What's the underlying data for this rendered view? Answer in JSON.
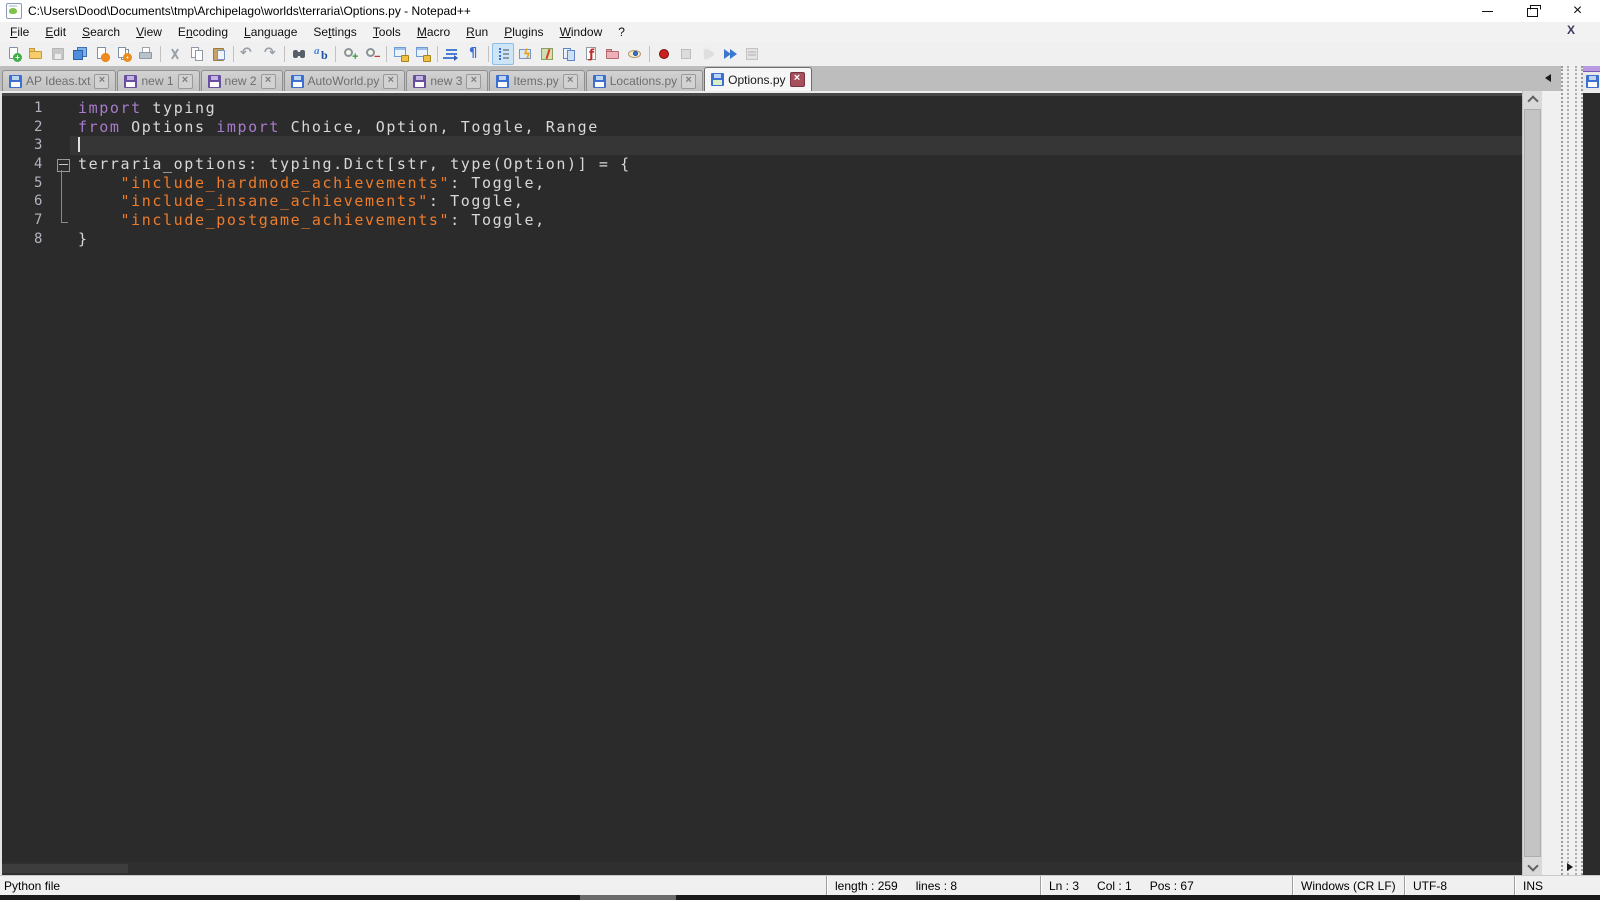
{
  "window": {
    "title": "C:\\Users\\Dood\\Documents\\tmp\\Archipelago\\worlds\\terraria\\Options.py - Notepad++"
  },
  "menu": {
    "items": [
      {
        "label": "File",
        "accel": 0
      },
      {
        "label": "Edit",
        "accel": 0
      },
      {
        "label": "Search",
        "accel": 0
      },
      {
        "label": "View",
        "accel": 0
      },
      {
        "label": "Encoding",
        "accel": 1
      },
      {
        "label": "Language",
        "accel": 0
      },
      {
        "label": "Settings",
        "accel": 2
      },
      {
        "label": "Tools",
        "accel": 0
      },
      {
        "label": "Macro",
        "accel": 0
      },
      {
        "label": "Run",
        "accel": 0
      },
      {
        "label": "Plugins",
        "accel": 0
      },
      {
        "label": "Window",
        "accel": 0
      },
      {
        "label": "?",
        "accel": -1
      }
    ],
    "close_x": "X"
  },
  "toolbar": {
    "groups": [
      [
        "new-file",
        "open-file",
        "save",
        "save-all",
        "close",
        "close-all",
        "print"
      ],
      [
        "cut",
        "copy",
        "paste"
      ],
      [
        "undo",
        "redo"
      ],
      [
        "find",
        "replace"
      ],
      [
        "zoom-in",
        "zoom-out"
      ],
      [
        "sync-vertical",
        "sync-horizontal"
      ],
      [
        "word-wrap",
        "show-all-characters"
      ],
      [
        "indent-guide",
        "plugin-lightning",
        "doc-map",
        "doc-list",
        "function-list",
        "folder-as-workspace",
        "monitoring"
      ],
      [
        "macro-record",
        "macro-stop",
        "macro-play",
        "macro-run-multiple",
        "macro-save"
      ]
    ],
    "pressed": [
      "indent-guide"
    ],
    "disabled": [
      "save",
      "macro-stop",
      "macro-play",
      "macro-save"
    ]
  },
  "tabs": {
    "items": [
      {
        "label": "AP Ideas.txt",
        "modified": false,
        "active": false
      },
      {
        "label": "new 1",
        "modified": true,
        "active": false
      },
      {
        "label": "new 2",
        "modified": true,
        "active": false
      },
      {
        "label": "AutoWorld.py",
        "modified": false,
        "active": false
      },
      {
        "label": "new 3",
        "modified": true,
        "active": false
      },
      {
        "label": "Items.py",
        "modified": false,
        "active": false
      },
      {
        "label": "Locations.py",
        "modified": false,
        "active": false
      },
      {
        "label": "Options.py",
        "modified": false,
        "active": true
      }
    ]
  },
  "editor": {
    "colors": {
      "background": "#2b2b2b",
      "current_line": "#363636",
      "text": "#d8d8d8",
      "keyword": "#a77bca",
      "string": "#ee7c2b",
      "line_number": "#b3b3c0"
    },
    "lines": [
      {
        "num": "1",
        "fold": null,
        "current": false,
        "caret": false,
        "segments": [
          {
            "t": "import",
            "c": "kw"
          },
          {
            "t": " typing",
            "c": "pl"
          }
        ]
      },
      {
        "num": "2",
        "fold": null,
        "current": false,
        "caret": false,
        "segments": [
          {
            "t": "from",
            "c": "kw"
          },
          {
            "t": " Options ",
            "c": "pl"
          },
          {
            "t": "import",
            "c": "kw"
          },
          {
            "t": " Choice, Option, Toggle, Range",
            "c": "pl"
          }
        ]
      },
      {
        "num": "3",
        "fold": null,
        "current": true,
        "caret": true,
        "segments": []
      },
      {
        "num": "4",
        "fold": "start",
        "current": false,
        "caret": false,
        "segments": [
          {
            "t": "terraria_options: typing.Dict[str, type(Option)] = {",
            "c": "pl"
          }
        ]
      },
      {
        "num": "5",
        "fold": "line",
        "current": false,
        "caret": false,
        "segments": [
          {
            "t": "    ",
            "c": "pl"
          },
          {
            "t": "\"include_hardmode_achievements\"",
            "c": "str"
          },
          {
            "t": ": Toggle,",
            "c": "pl"
          }
        ]
      },
      {
        "num": "6",
        "fold": "line",
        "current": false,
        "caret": false,
        "segments": [
          {
            "t": "    ",
            "c": "pl"
          },
          {
            "t": "\"include_insane_achievements\"",
            "c": "str"
          },
          {
            "t": ": Toggle,",
            "c": "pl"
          }
        ]
      },
      {
        "num": "7",
        "fold": "end",
        "current": false,
        "caret": false,
        "segments": [
          {
            "t": "    ",
            "c": "pl"
          },
          {
            "t": "\"include_postgame_achievements\"",
            "c": "str"
          },
          {
            "t": ": Toggle,",
            "c": "pl"
          }
        ]
      },
      {
        "num": "8",
        "fold": null,
        "current": false,
        "caret": false,
        "segments": [
          {
            "t": "}",
            "c": "pl"
          }
        ]
      }
    ]
  },
  "status": {
    "doc_type": "Python file",
    "length": "length : 259",
    "lines": "lines : 8",
    "ln": "Ln : 3",
    "col": "Col : 1",
    "pos": "Pos : 67",
    "eol": "Windows (CR LF)",
    "encoding": "UTF-8",
    "mode": "INS"
  }
}
